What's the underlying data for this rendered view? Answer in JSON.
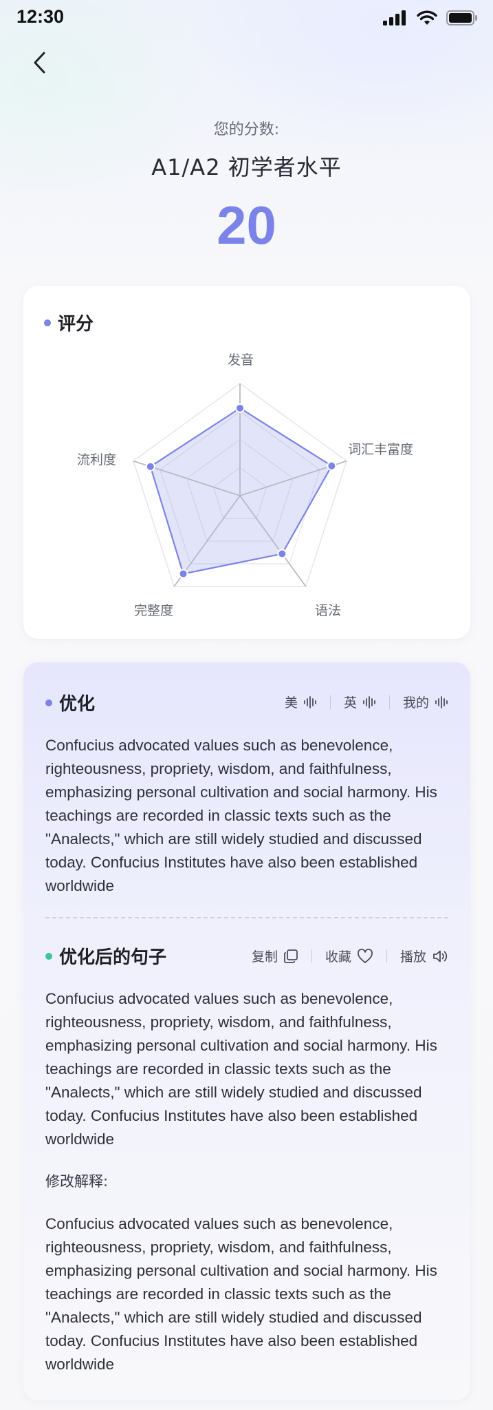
{
  "status_bar": {
    "time": "12:30"
  },
  "header": {
    "score_label": "您的分数:",
    "level": "A1/A2 初学者水平",
    "score": "20"
  },
  "rating": {
    "title": "评分",
    "accent_color": "#7b83e8",
    "axes": [
      "发音",
      "词汇丰富度",
      "语法",
      "完整度",
      "流利度"
    ]
  },
  "chart_data": {
    "type": "radar",
    "categories": [
      "发音",
      "词汇丰富度",
      "语法",
      "完整度",
      "流利度"
    ],
    "series": [
      {
        "values": [
          0.78,
          0.86,
          0.64,
          0.86,
          0.84
        ]
      }
    ],
    "range": [
      0,
      1
    ],
    "grid": true
  },
  "optimize": {
    "title": "优化",
    "voices": [
      {
        "label": "美",
        "icon": "voice-wave-icon"
      },
      {
        "label": "英",
        "icon": "voice-wave-icon"
      },
      {
        "label": "我的",
        "icon": "voice-wave-icon"
      }
    ],
    "original_text": "Confucius advocated values such as benevolence, righteousness, propriety, wisdom, and faithfulness, emphasizing personal cultivation and social harmony. His teachings are recorded in classic texts such as the \"Analects,\" which are still widely studied and discussed today. Confucius Institutes have also been established worldwide"
  },
  "optimized": {
    "title": "优化后的句子",
    "accent_color": "#3bc598",
    "actions": [
      {
        "label": "复制",
        "icon": "copy-icon"
      },
      {
        "label": "收藏",
        "icon": "heart-icon"
      },
      {
        "label": "播放",
        "icon": "speaker-icon"
      }
    ],
    "sentence": "Confucius advocated values such as benevolence, righteousness, propriety, wisdom, and faithfulness, emphasizing personal cultivation and social harmony. His teachings are recorded in classic texts such as the \"Analects,\" which are still widely studied and discussed today. Confucius Institutes have also been established worldwide",
    "explanation_label": "修改解释:",
    "explanation": "Confucius advocated values such as benevolence, righteousness, propriety, wisdom, and faithfulness, emphasizing personal cultivation and social harmony. His teachings are recorded in classic texts such as the \"Analects,\" which are still widely studied and discussed today. Confucius Institutes have also been established worldwide"
  }
}
